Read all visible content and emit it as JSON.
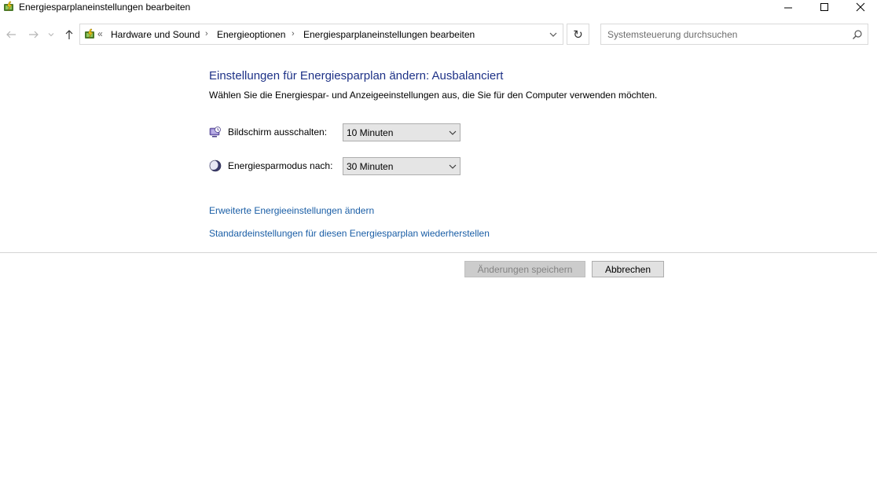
{
  "window": {
    "title": "Energiesparplaneinstellungen bearbeiten",
    "minimize_icon": "minimize-icon",
    "maximize_icon": "maximize-icon",
    "close_icon": "close-icon"
  },
  "nav": {
    "breadcrumb_overflow": "«",
    "breadcrumbs": [
      "Hardware und Sound",
      "Energieoptionen",
      "Energiesparplaneinstellungen bearbeiten"
    ],
    "separator": "›",
    "refresh_glyph": "↻"
  },
  "search": {
    "placeholder": "Systemsteuerung durchsuchen"
  },
  "main": {
    "heading": "Einstellungen für Energiesparplan ändern: Ausbalanciert",
    "subtext": "Wählen Sie die Energiespar- und Anzeigeeinstellungen aus, die Sie für den Computer verwenden möchten.",
    "settings": [
      {
        "label": "Bildschirm ausschalten:",
        "value": "10 Minuten",
        "icon": "display-off-icon"
      },
      {
        "label": "Energiesparmodus nach:",
        "value": "30 Minuten",
        "icon": "sleep-moon-icon"
      }
    ],
    "links": [
      "Erweiterte Energieeinstellungen ändern",
      "Standardeinstellungen für diesen Energiesparplan wiederherstellen"
    ]
  },
  "buttons": {
    "save": "Änderungen speichern",
    "cancel": "Abbrechen"
  },
  "colors": {
    "heading": "#1e3287",
    "link": "#1a5ea6",
    "background": "#ffffff"
  }
}
